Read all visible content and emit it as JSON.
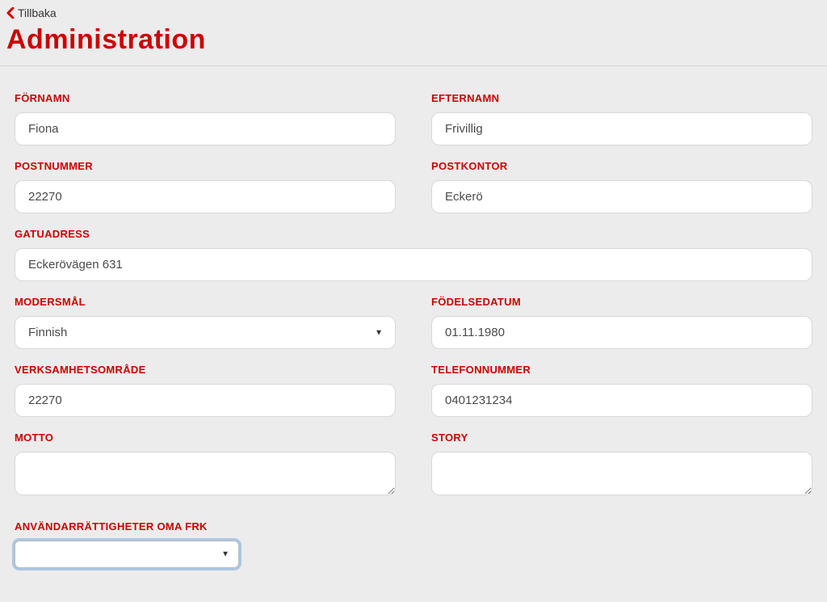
{
  "colors": {
    "accent": "#cc0000",
    "background": "#ececec"
  },
  "header": {
    "back_label": "Tillbaka",
    "title": "Administration"
  },
  "form": {
    "fornamn": {
      "label": "FÖRNAMN",
      "value": "Fiona"
    },
    "efternamn": {
      "label": "EFTERNAMN",
      "value": "Frivillig"
    },
    "postnummer": {
      "label": "POSTNUMMER",
      "value": "22270"
    },
    "postkontor": {
      "label": "POSTKONTOR",
      "value": "Eckerö"
    },
    "gatuadress": {
      "label": "GATUADRESS",
      "value": "Eckerövägen 631"
    },
    "modersmal": {
      "label": "MODERSMÅL",
      "selected": "Finnish",
      "options": [
        "Finnish"
      ]
    },
    "fodelsedatum": {
      "label": "FÖDELSEDATUM",
      "value": "01.11.1980"
    },
    "verksamhetsomrade": {
      "label": "VERKSAMHETSOMRÅDE",
      "value": "22270"
    },
    "telefonnummer": {
      "label": "TELEFONNUMMER",
      "value": "0401231234"
    },
    "motto": {
      "label": "MOTTO",
      "value": ""
    },
    "story": {
      "label": "STORY",
      "value": ""
    },
    "rattigheter": {
      "label": "ANVÄNDARRÄTTIGHETER OMA FRK",
      "selected": ""
    }
  }
}
